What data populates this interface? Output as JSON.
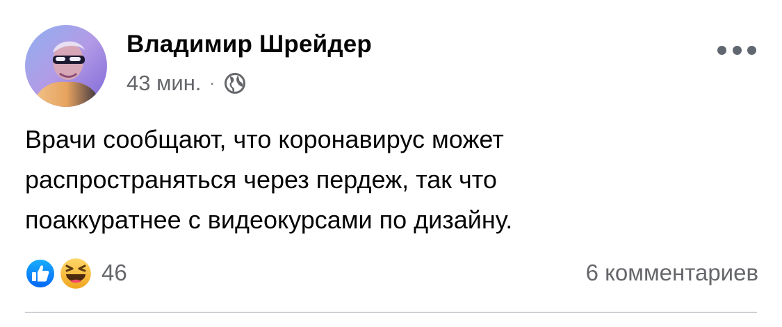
{
  "post": {
    "author": "Владимир Шрейдер",
    "timestamp": "43 мин.",
    "separator": "·",
    "privacy_icon": "globe-icon",
    "more_icon": "more-options-icon",
    "text_lines": [
      "Врачи сообщают, что коронавирус может",
      "распространяться через пердеж, так что",
      "поаккуратнее с видеокурсами по дизайну."
    ]
  },
  "reactions": {
    "icons": [
      "like-icon",
      "haha-icon"
    ],
    "count": "46",
    "comments": "6 комментариев"
  },
  "colors": {
    "text": "#050505",
    "secondary": "#65676b",
    "like_blue": "#1877f2",
    "haha_yellow": "#f7b125",
    "divider": "#ced0d4"
  }
}
